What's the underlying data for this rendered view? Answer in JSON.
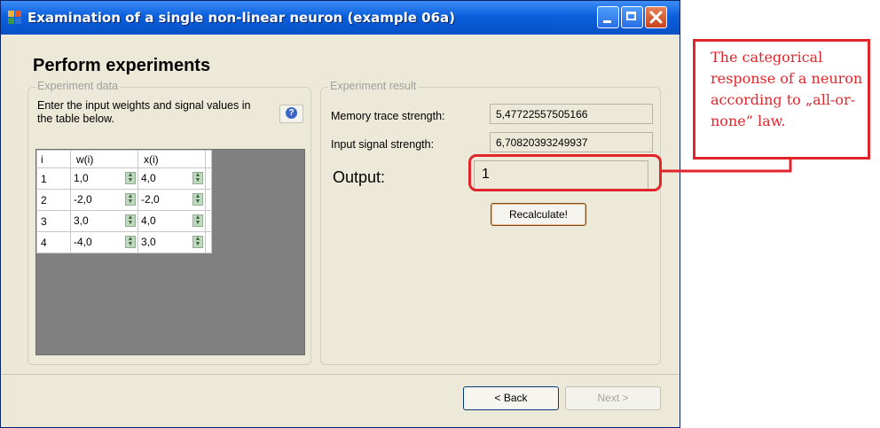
{
  "window": {
    "title": "Examination of a single non-linear neuron (example 06a)"
  },
  "page": {
    "heading": "Perform experiments"
  },
  "experiment_data": {
    "legend": "Experiment data",
    "instructions": "Enter the input weights and signal values in the table below.",
    "help_icon": "question-icon",
    "columns": [
      "i",
      "w(i)",
      "x(i)"
    ],
    "rows": [
      {
        "i": "1",
        "w": "1,0",
        "x": "4,0"
      },
      {
        "i": "2",
        "w": "-2,0",
        "x": "-2,0"
      },
      {
        "i": "3",
        "w": "3,0",
        "x": "4,0"
      },
      {
        "i": "4",
        "w": "-4,0",
        "x": "3,0"
      }
    ]
  },
  "experiment_result": {
    "legend": "Experiment result",
    "memory_label": "Memory trace strength:",
    "memory_value": "5,47722557505166",
    "signal_label": "Input signal strength:",
    "signal_value": "6,70820393249937",
    "output_label": "Output:",
    "output_value": "1",
    "recalc_label": "Recalculate!"
  },
  "footer": {
    "back_label": "< Back",
    "next_label": "Next >"
  },
  "annotation": {
    "text": "The categorical response of a neuron according to „all-or-none” law.",
    "color": "#e0262b"
  }
}
